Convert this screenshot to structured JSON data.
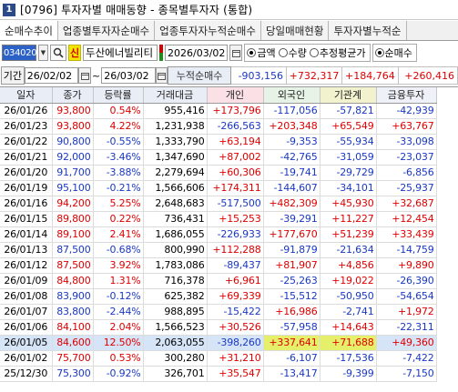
{
  "window": {
    "number": "1",
    "title": "[0796] 투자자별 매매동향 - 종목별투자자 (통합)"
  },
  "tabs": [
    "순매수추이",
    "업종별투자자순매수",
    "업종투자자누적순매수",
    "당일매매현황",
    "투자자별누적순"
  ],
  "controls": {
    "code": "034020",
    "shin": "신",
    "stock_name": "두산에너빌리티",
    "date": "2026/03/02",
    "amount_radio": {
      "options": [
        "금액",
        "수량",
        "추정평균가"
      ],
      "selected": "금액"
    },
    "net_radio": {
      "options": [
        "순매수"
      ],
      "selected": "순매수"
    }
  },
  "period": {
    "label": "기간",
    "from": "26/02/02",
    "to": "26/03/02",
    "sum_label": "누적순매수",
    "sums": [
      "-903,156",
      "+732,317",
      "+184,764",
      "+260,416"
    ]
  },
  "colors": {
    "up": "#e00000",
    "down": "#1a39c4",
    "highlight": "#e6ef6a",
    "selected_row": "#d6e4f7"
  },
  "table": {
    "headers": [
      "일자",
      "종가",
      "등락률",
      "거래대금",
      "개인",
      "외국인",
      "기관계",
      "금융투자"
    ],
    "rows": [
      [
        "26/01/26",
        "93,800",
        "0.54%",
        "955,416",
        "+173,796",
        "-117,056",
        "-57,821",
        "-42,939"
      ],
      [
        "26/01/23",
        "93,800",
        "4.22%",
        "1,231,938",
        "-266,563",
        "+203,348",
        "+65,549",
        "+63,767"
      ],
      [
        "26/01/22",
        "90,800",
        "-0.55%",
        "1,333,790",
        "+63,194",
        "-9,353",
        "-55,934",
        "-33,098"
      ],
      [
        "26/01/21",
        "92,000",
        "-3.46%",
        "1,347,690",
        "+87,002",
        "-42,765",
        "-31,059",
        "-23,037"
      ],
      [
        "26/01/20",
        "91,700",
        "-3.88%",
        "2,279,694",
        "+60,306",
        "-19,741",
        "-29,729",
        "-6,856"
      ],
      [
        "26/01/19",
        "95,100",
        "-0.21%",
        "1,566,606",
        "+174,311",
        "-144,607",
        "-34,101",
        "-25,937"
      ],
      [
        "26/01/16",
        "94,200",
        "5.25%",
        "2,648,683",
        "-517,500",
        "+482,309",
        "+45,930",
        "+32,687"
      ],
      [
        "26/01/15",
        "89,800",
        "0.22%",
        "736,431",
        "+15,253",
        "-39,291",
        "+11,227",
        "+12,454"
      ],
      [
        "26/01/14",
        "89,100",
        "2.41%",
        "1,686,055",
        "-226,933",
        "+177,670",
        "+51,239",
        "+33,439"
      ],
      [
        "26/01/13",
        "87,500",
        "-0.68%",
        "800,990",
        "+112,288",
        "-91,879",
        "-21,634",
        "-14,759"
      ],
      [
        "26/01/12",
        "87,500",
        "3.92%",
        "1,783,086",
        "-89,437",
        "+81,907",
        "+4,856",
        "+9,890"
      ],
      [
        "26/01/09",
        "84,800",
        "1.31%",
        "716,378",
        "+6,961",
        "-25,263",
        "+19,022",
        "-26,390"
      ],
      [
        "26/01/08",
        "83,900",
        "-0.12%",
        "625,382",
        "+69,339",
        "-15,512",
        "-50,950",
        "-54,654"
      ],
      [
        "26/01/07",
        "83,800",
        "-2.44%",
        "988,895",
        "-15,422",
        "+16,986",
        "-2,741",
        "+1,972"
      ],
      [
        "26/01/06",
        "84,100",
        "2.04%",
        "1,566,523",
        "+30,526",
        "-57,958",
        "+14,643",
        "-22,311"
      ],
      [
        "26/01/05",
        "84,600",
        "12.50%",
        "2,063,055",
        "-398,260",
        "+337,641",
        "+71,688",
        "+49,360"
      ],
      [
        "26/01/02",
        "75,700",
        "0.53%",
        "300,280",
        "+31,210",
        "-6,107",
        "-17,536",
        "-7,422"
      ],
      [
        "25/12/30",
        "75,300",
        "-0.92%",
        "326,701",
        "+35,547",
        "-13,417",
        "-9,399",
        "-7,150"
      ]
    ],
    "selected_row": 15,
    "highlighted_cells": [
      [
        15,
        5
      ],
      [
        15,
        6
      ]
    ]
  }
}
